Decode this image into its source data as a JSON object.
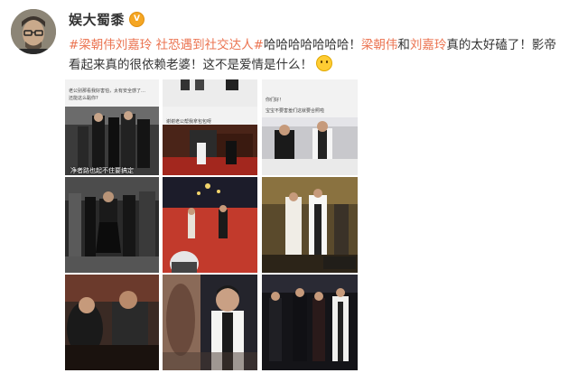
{
  "user": {
    "name": "娱大蜀黍",
    "verified_badge": "V",
    "badge_color": "#f5a623"
  },
  "post": {
    "topic": "#梁朝伟刘嘉玲 社恐遇到社交达人#",
    "text_1": "哈哈哈哈哈哈哈！",
    "mention_1": "梁朝伟",
    "text_2": "和",
    "mention_2": "刘嘉玲",
    "text_3": "真的太好磕了！影帝看起来真的很依赖老婆！这不是爱情是什么！",
    "emoji": "shy-emoji",
    "topic_color": "#eb7350",
    "text_color": "#333333"
  },
  "images": [
    {
      "caption_top": "老公别那看我好害怕，太有安全感了…",
      "caption_bottom": "还能这么黏你?",
      "subtitle": ""
    },
    {
      "caption_top": "谢谢老公帮我拿包包呀",
      "caption_bottom": "",
      "subtitle": ""
    },
    {
      "caption_top": "你们好！",
      "caption_bottom": "宝宝不要害羞们这就要合照啦",
      "subtitle": ""
    },
    {
      "caption_top": "",
      "caption_bottom": "",
      "subtitle": "净者路也起不住要搞定"
    },
    {
      "caption_top": "",
      "caption_bottom": "",
      "subtitle": ""
    },
    {
      "caption_top": "",
      "caption_bottom": "",
      "subtitle": ""
    },
    {
      "caption_top": "",
      "caption_bottom": "",
      "subtitle": ""
    },
    {
      "caption_top": "",
      "caption_bottom": "",
      "subtitle": ""
    },
    {
      "caption_top": "",
      "caption_bottom": "",
      "subtitle": ""
    }
  ]
}
